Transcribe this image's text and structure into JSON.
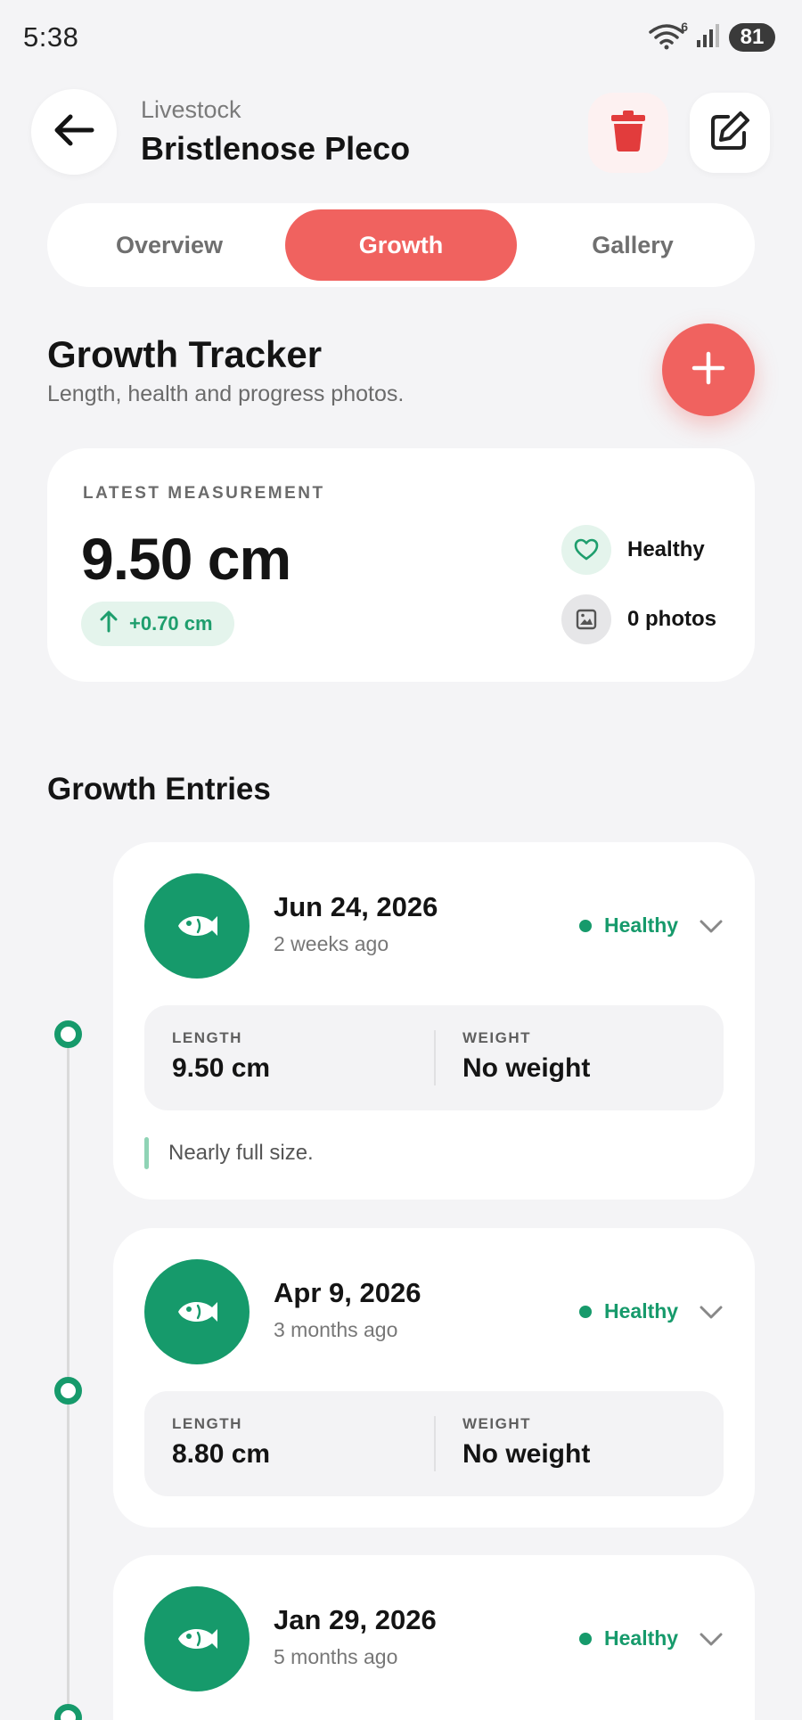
{
  "status_bar": {
    "time": "5:38",
    "wifi_badge": "6",
    "battery": "81"
  },
  "header": {
    "subtitle": "Livestock",
    "title": "Bristlenose Pleco",
    "back_icon": "arrow-left-icon",
    "delete_icon": "trash-icon",
    "edit_icon": "edit-icon"
  },
  "tabs": [
    {
      "label": "Overview",
      "active": false
    },
    {
      "label": "Growth",
      "active": true
    },
    {
      "label": "Gallery",
      "active": false
    }
  ],
  "section": {
    "title": "Growth Tracker",
    "subtitle": "Length, health and progress photos."
  },
  "latest": {
    "label": "LATEST MEASUREMENT",
    "value": "9.50 cm",
    "delta": "+0.70 cm",
    "health": "Healthy",
    "photos": "0 photos"
  },
  "entries_title": "Growth Entries",
  "entries": [
    {
      "date": "Jun 24, 2026",
      "ago": "2 weeks ago",
      "status": "Healthy",
      "length_label": "LENGTH",
      "length": "9.50 cm",
      "weight_label": "WEIGHT",
      "weight": "No weight",
      "note": "Nearly full size."
    },
    {
      "date": "Apr 9, 2026",
      "ago": "3 months ago",
      "status": "Healthy",
      "length_label": "LENGTH",
      "length": "8.80 cm",
      "weight_label": "WEIGHT",
      "weight": "No weight"
    },
    {
      "date": "Jan 29, 2026",
      "ago": "5 months ago",
      "status": "Healthy"
    }
  ],
  "colors": {
    "accent": "#f0625f",
    "success": "#169a6b",
    "background": "#f4f4f6"
  }
}
